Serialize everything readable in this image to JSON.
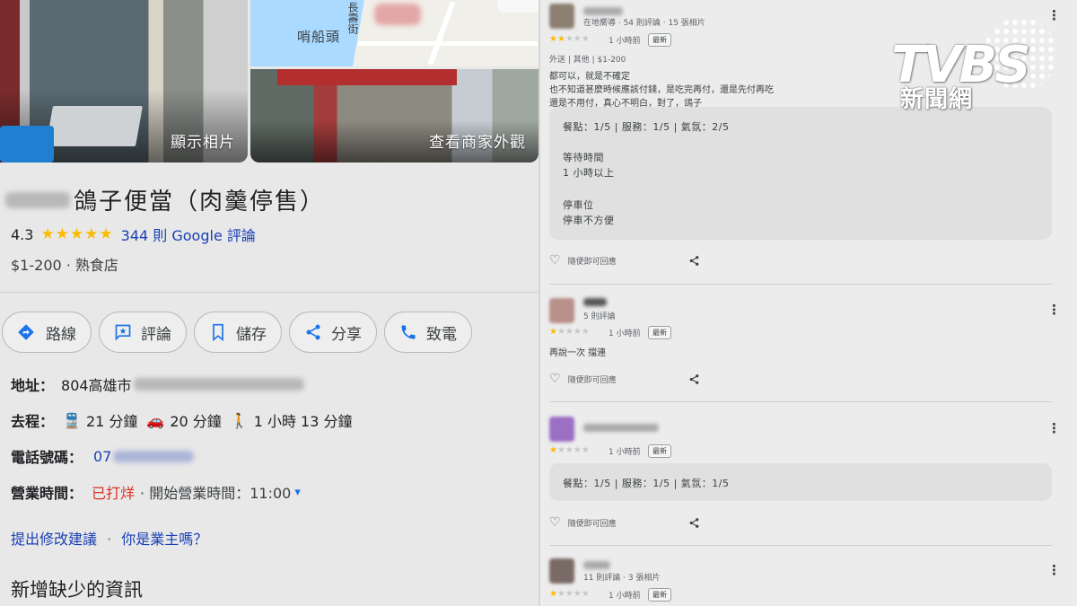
{
  "photos": {
    "main_caption": "顯示相片",
    "map_label_1": "哨船頭",
    "map_label_2": "長壽街",
    "street_caption": "查看商家外觀"
  },
  "place": {
    "title": "鴿子便當（肉羹停售）",
    "rating": "4.3",
    "stars": "★★★★★",
    "reviews_link": "344 則 Google 評論",
    "price_category": "$1-200 · 熟食店"
  },
  "actions": {
    "directions": "路線",
    "review": "評論",
    "save": "儲存",
    "share": "分享",
    "call": "致電"
  },
  "info": {
    "address_label": "地址：",
    "address_value": "804高雄市",
    "travel_label": "去程：",
    "transit_time": "21 分鐘",
    "drive_time": "20 分鐘",
    "walk_time": "1 小時 13 分鐘",
    "phone_label": "電話號碼：",
    "phone_value": "07",
    "hours_label": "營業時間：",
    "hours_status": "已打烊",
    "hours_next": "· 開始營業時間：11:00",
    "hours_caret": "▾",
    "suggest_edit": "提出修改建議",
    "separator": "·",
    "owner_link": "你是業主嗎？",
    "missing_info": "新增缺少的資訊"
  },
  "reviews": [
    {
      "meta": "在地嚮導 · 54 則評論 · 15 張相片",
      "stars_on": "★★",
      "stars_off": "★★★",
      "time": "1 小時前",
      "new_badge": "最新",
      "tags": "外送 | 其他 | $1-200",
      "lines": [
        "都可以，就是不確定",
        "也不知道甚麼時候應該付錢，是吃完再付，還是先付再吃",
        "還是不用付，真心不明白，對了，鴿子"
      ],
      "box": [
        "餐點：1/5 | 服務：1/5 | 氣氛：2/5",
        "等待時間",
        "1 小時以上",
        "停車位",
        "停車不方便"
      ],
      "like": "隨便即可回應"
    },
    {
      "meta": "5 則評論",
      "stars_on": "★",
      "stars_off": "★★★★",
      "time": "1 小時前",
      "new_badge": "最新",
      "lines": [
        "再說一次 擋連"
      ],
      "like": "隨便即可回應"
    },
    {
      "stars_on": "★",
      "stars_off": "★★★★",
      "time": "1 小時前",
      "new_badge": "最新",
      "box": [
        "餐點：1/5 | 服務：1/5 | 氣氛：1/5"
      ],
      "like": "隨便即可回應"
    },
    {
      "meta": "11 則評論 · 3 張相片",
      "stars_on": "★",
      "stars_off": "★★★★",
      "time": "1 小時前",
      "new_badge": "最新"
    }
  ],
  "icons": {
    "more": "⋮",
    "heart": "♡",
    "transit": "🚆",
    "car": "🚗",
    "walk": "🚶"
  },
  "logo": {
    "brand": "TVBS",
    "sub": "新聞網"
  },
  "colors": {
    "star": "#fbbc04",
    "link": "#1a3fb5",
    "closed": "#d93025",
    "icon_blue": "#1a73e8"
  }
}
